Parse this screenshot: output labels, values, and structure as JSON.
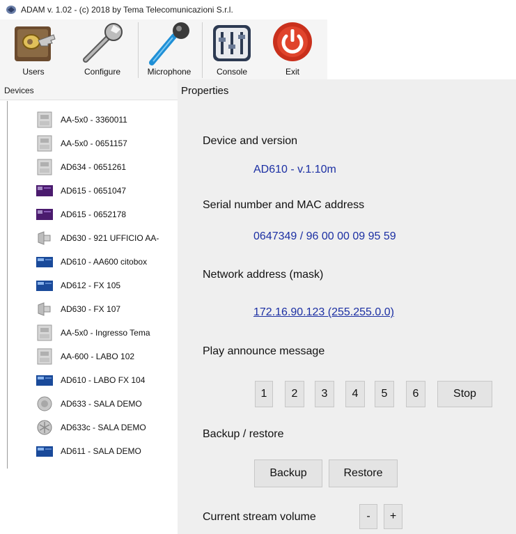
{
  "window": {
    "title": "ADAM v. 1.02 - (c) 2018 by Tema Telecomunicazioni S.r.l.",
    "icon": "app-icon"
  },
  "toolbar": {
    "items": [
      {
        "label": "Users",
        "icon": "users-keys-icon"
      },
      {
        "label": "Configure",
        "icon": "wrench-icon"
      },
      {
        "label": "Microphone",
        "icon": "microphone-icon"
      },
      {
        "label": "Console",
        "icon": "console-icon"
      },
      {
        "label": "Exit",
        "icon": "power-icon"
      }
    ]
  },
  "devices": {
    "header": "Devices",
    "items": [
      {
        "label": "AA-5x0 - 3360011",
        "icon": "gray-panel-icon"
      },
      {
        "label": "AA-5x0 - 0651157",
        "icon": "gray-panel-icon"
      },
      {
        "label": "AD634 - 0651261",
        "icon": "gray-panel-icon"
      },
      {
        "label": "AD615 - 0651047",
        "icon": "purple-device-icon"
      },
      {
        "label": "AD615 - 0652178",
        "icon": "purple-device-icon"
      },
      {
        "label": "AD630 - 921 UFFICIO AA-",
        "icon": "speaker-icon"
      },
      {
        "label": "AD610 - AA600 citobox",
        "icon": "blue-device-icon"
      },
      {
        "label": "AD612 - FX 105",
        "icon": "blue-device-icon"
      },
      {
        "label": "AD630 - FX 107",
        "icon": "speaker-icon"
      },
      {
        "label": "AA-5x0 - Ingresso Tema",
        "icon": "gray-panel-icon"
      },
      {
        "label": "AA-600 - LABO 102",
        "icon": "gray-panel-icon"
      },
      {
        "label": "AD610 - LABO FX 104",
        "icon": "blue-device-icon"
      },
      {
        "label": "AD633 - SALA DEMO",
        "icon": "round-speaker-icon"
      },
      {
        "label": "AD633c - SALA DEMO",
        "icon": "round-speaker-icon"
      },
      {
        "label": "AD611 - SALA DEMO",
        "icon": "blue-device-icon"
      }
    ]
  },
  "properties": {
    "title": "Properties",
    "device_version_label": "Device and version",
    "device_version_value": "AD610 - v.1.10m",
    "serial_label": "Serial number and MAC address",
    "serial_value": "0647349 / 96 00 00 09 95 59",
    "network_label": "Network address (mask)",
    "network_value": "172.16.90.123 (255.255.0.0)",
    "announce_label": "Play announce message",
    "announce_buttons": [
      "1",
      "2",
      "3",
      "4",
      "5",
      "6"
    ],
    "stop_label": "Stop",
    "backup_section_label": "Backup / restore",
    "backup_button": "Backup",
    "restore_button": "Restore",
    "volume_label": "Current stream volume",
    "volume_minus": "-",
    "volume_plus": "+"
  },
  "colors": {
    "link_blue": "#1b2fa3",
    "panel_bg": "#efefef",
    "toolbar_bg": "#f5f5f5"
  }
}
